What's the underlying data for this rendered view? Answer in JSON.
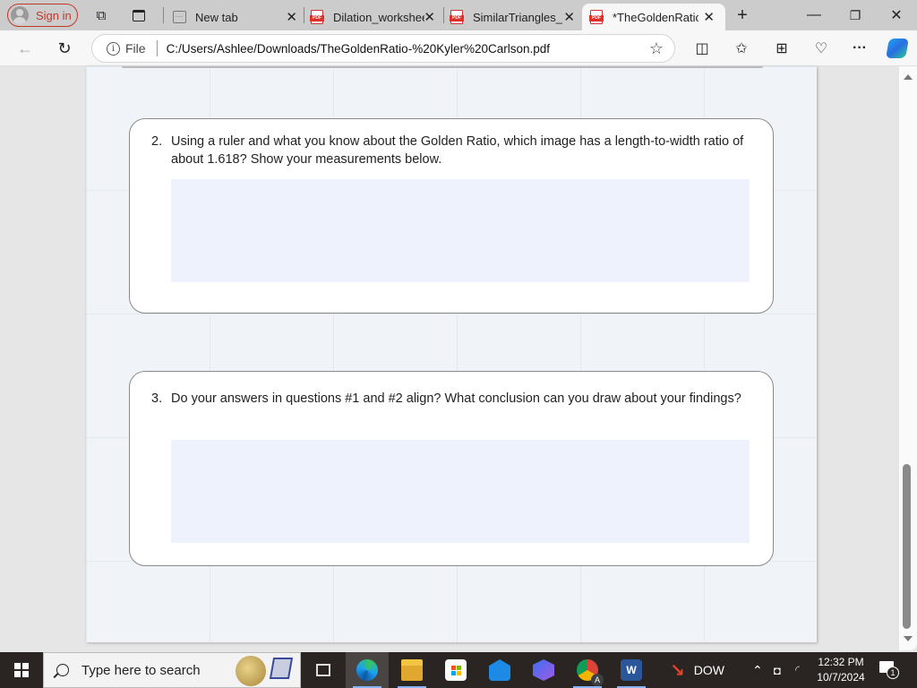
{
  "browser": {
    "profile": {
      "label": "Sign in"
    },
    "tabs": [
      {
        "label": "New tab",
        "icon": "new-tab-icon",
        "active": false
      },
      {
        "label": "Dilation_workshee",
        "icon": "pdf-icon",
        "active": false
      },
      {
        "label": "SimilarTriangles_w",
        "icon": "pdf-icon",
        "active": false
      },
      {
        "label": "*TheGoldenRatio-",
        "icon": "pdf-icon",
        "active": true
      }
    ],
    "new_tab_symbol": "+",
    "close_symbol": "✕",
    "window_controls": {
      "minimize": "—",
      "restore": "❐",
      "close": "✕"
    },
    "address": {
      "scheme_label": "File",
      "url": "C:/Users/Ashlee/Downloads/TheGoldenRatio-%20Kyler%20Carlson.pdf"
    },
    "toolbar_icons": [
      "split-screen-icon",
      "favorites-icon",
      "collections-icon",
      "browser-essentials-icon",
      "more-icon",
      "copilot-icon"
    ],
    "more_symbol": "···"
  },
  "document": {
    "questions": [
      {
        "number": "2.",
        "text": "Using a ruler and what you know about the Golden Ratio, which image has a length-to-width ratio of about 1.618? Show your measurements below.",
        "answer": ""
      },
      {
        "number": "3.",
        "text": "Do your answers in questions #1 and #2 align? What conclusion can you draw about your findings?",
        "answer": ""
      }
    ]
  },
  "taskbar": {
    "search_placeholder": "Type here to search",
    "pinned_apps": [
      "task-view",
      "edge",
      "file-explorer",
      "microsoft-store",
      "mail",
      "microsoft-365",
      "chrome",
      "word"
    ],
    "stock": {
      "label": "DOW",
      "trend": "down"
    },
    "time": "12:32 PM",
    "date": "10/7/2024",
    "notification_count": "1"
  }
}
